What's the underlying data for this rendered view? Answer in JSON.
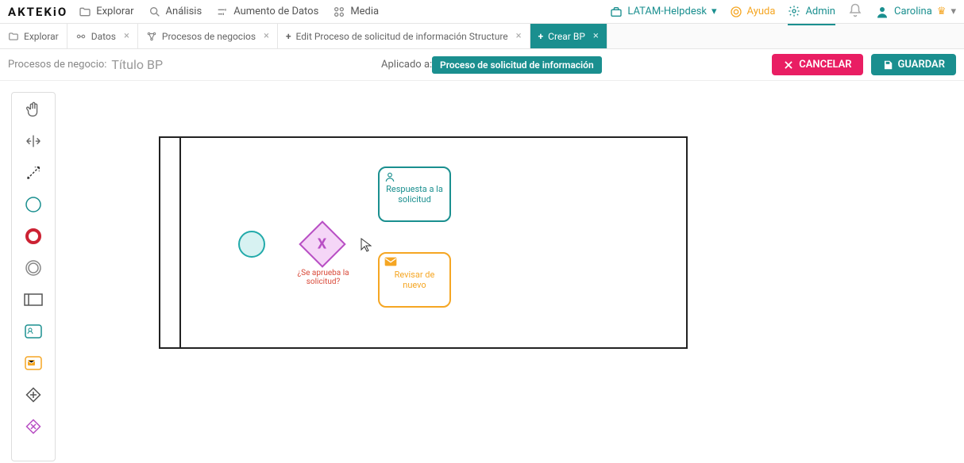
{
  "brand": "AKTEKiO",
  "topnav": {
    "explore": "Explorar",
    "analysis": "Análisis",
    "augment": "Aumento de Datos",
    "media": "Media"
  },
  "workspace": {
    "name": "LATAM-Helpdesk"
  },
  "help": "Ayuda",
  "admin": "Admin",
  "user": {
    "name": "Carolina"
  },
  "tabs": {
    "explore": "Explorar",
    "data": "Datos",
    "processes": "Procesos de negocios",
    "edit_structure": "Edit Proceso de solicitud de información Structure",
    "create_bp": "Crear BP"
  },
  "actionbar": {
    "crumb": "Procesos de negocio:",
    "title_placeholder": "Título BP",
    "applied_label": "Aplicado a:",
    "applied_value": "Proceso de solicitud de información",
    "cancel": "CANCELAR",
    "save": "GUARDAR"
  },
  "palette": {
    "hand": "hand-tool",
    "lasso": "lasso-tool",
    "connect": "connect-tool",
    "start_event_thin": "start-event",
    "start_event_bold": "end-event",
    "intermediate": "intermediate-event",
    "pool": "pool",
    "user_task": "user-task",
    "mail_task": "mail-task",
    "gateway_plus": "parallel-gateway",
    "gateway_x": "exclusive-gateway"
  },
  "diagram": {
    "gateway_label": "¿Se aprueba la solicitud?",
    "task_user": "Respuesta a la solicitud",
    "task_mail": "Revisar de nuevo"
  }
}
